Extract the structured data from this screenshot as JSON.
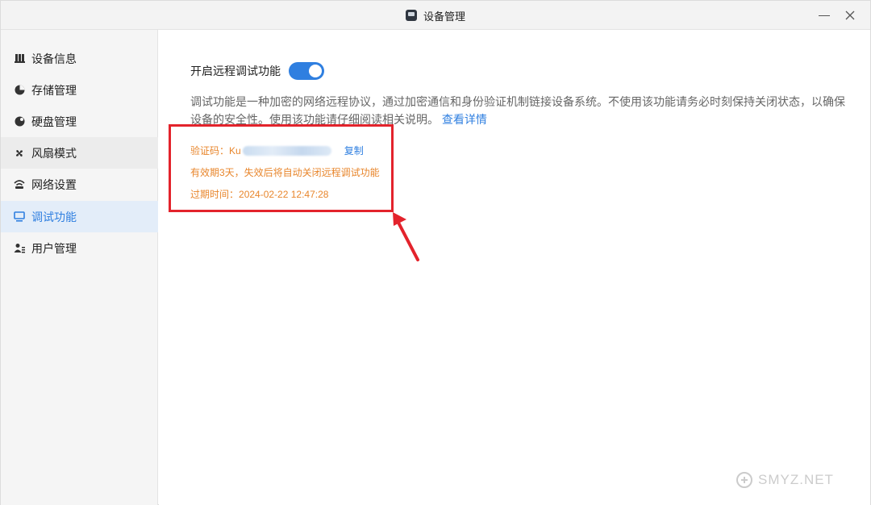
{
  "window": {
    "title": "设备管理",
    "app_icon": "device-icon"
  },
  "sidebar": {
    "items": [
      {
        "label": "设备信息",
        "icon": "device-info-icon",
        "state": "normal"
      },
      {
        "label": "存储管理",
        "icon": "pie-chart-icon",
        "state": "normal"
      },
      {
        "label": "硬盘管理",
        "icon": "disk-icon",
        "state": "normal"
      },
      {
        "label": "风扇模式",
        "icon": "fan-icon",
        "state": "hover"
      },
      {
        "label": "网络设置",
        "icon": "network-icon",
        "state": "normal"
      },
      {
        "label": "调试功能",
        "icon": "monitor-icon",
        "state": "active"
      },
      {
        "label": "用户管理",
        "icon": "users-icon",
        "state": "normal"
      }
    ]
  },
  "main": {
    "toggle_label": "开启远程调试功能",
    "toggle_on": true,
    "description": "调试功能是一种加密的网络远程协议，通过加密通信和身份验证机制链接设备系统。不使用该功能请务必时刻保持关闭状态，以确保设备的安全性。使用该功能请仔细阅读相关说明。",
    "details_link": "查看详情",
    "code_label": "验证码：",
    "code_prefix": "Ku",
    "copy_label": "复制",
    "validity_text": "有效期3天，失效后将自动关闭远程调试功能",
    "expiry_label": "过期时间：",
    "expiry_value": "2024-02-22 12:47:28"
  },
  "colors": {
    "accent": "#2f7fe0",
    "warning_text": "#e8862c",
    "annotation": "#e3232c"
  },
  "watermark": {
    "text": "SMYZ.NET"
  }
}
